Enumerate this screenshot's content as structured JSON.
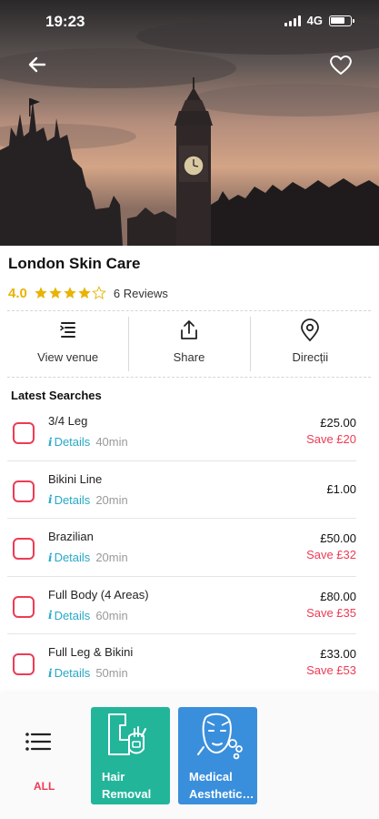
{
  "status": {
    "time": "19:23",
    "network": "4G"
  },
  "venue": {
    "name": "London Skin Care",
    "rating": "4.0",
    "rating_value": 4,
    "reviews": "6 Reviews"
  },
  "actions": [
    {
      "label": "View venue",
      "icon": "list-icon"
    },
    {
      "label": "Share",
      "icon": "share-icon"
    },
    {
      "label": "Direcții",
      "icon": "location-pin-icon"
    }
  ],
  "list": {
    "title": "Latest Searches",
    "details_label": "Details",
    "items": [
      {
        "name": "3/4 Leg",
        "duration": "40min",
        "price": "£25.00",
        "save": "Save £20"
      },
      {
        "name": "Bikini Line",
        "duration": "20min",
        "price": "£1.00",
        "save": ""
      },
      {
        "name": "Brazilian",
        "duration": "20min",
        "price": "£50.00",
        "save": "Save £32"
      },
      {
        "name": "Full Body (4 Areas)",
        "duration": "60min",
        "price": "£80.00",
        "save": "Save £35"
      },
      {
        "name": "Full Leg & Bikini",
        "duration": "50min",
        "price": "£33.00",
        "save": "Save £53"
      }
    ]
  },
  "bottom": {
    "all_label": "ALL",
    "categories": [
      {
        "line1": "Hair",
        "line2": "Removal",
        "color": "#22b59a"
      },
      {
        "line1": "Medical",
        "line2": "Aesthetic…",
        "color": "#3a8fdc"
      }
    ]
  },
  "colors": {
    "accent_red": "#ee3b55",
    "link_blue": "#27a9c6",
    "star_gold": "#e9b300"
  }
}
